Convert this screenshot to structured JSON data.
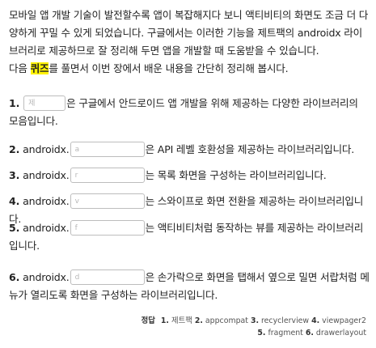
{
  "intro": {
    "line1": "모바일 앱 개발 기술이 발전할수록 앱이 복잡해지다 보니 액티비티의 화면도 조금 더 다양하게 꾸밀 수 있게 되었습니다. 구글에서는 이러한 기능을 제트팩의 androidx 라이브러리로 제공하므로 잘 정리해 두면 앱을 개발할 때 도움받을 수 있습니다.",
    "line2_before": "다음 ",
    "line2_highlight": "퀴즈",
    "line2_after": "를 풀면서 이번 장에서 배운 내용을 간단히 정리해 봅시다."
  },
  "questions": [
    {
      "num": "1.",
      "prefix": "",
      "blank_placeholder": "제",
      "text": "은 구글에서 안드로이드 앱 개발을 위해 제공하는 다양한 라이브러리의 모음입니다."
    },
    {
      "num": "2.",
      "prefix": "androidx.",
      "blank_placeholder": "a",
      "text": "은 API 레벨 호환성을 제공하는 라이브러리입니다."
    },
    {
      "num": "3.",
      "prefix": "androidx.",
      "blank_placeholder": "r",
      "text": "는 목록 화면을 구성하는 라이브러리입니다."
    },
    {
      "num": "4.",
      "prefix": "androidx.",
      "blank_placeholder": "v",
      "text": "는 스와이프로 화면 전환을 제공하는 라이브러리입니다."
    },
    {
      "num": "5.",
      "prefix": "androidx.",
      "blank_placeholder": "f",
      "text": "는 액티비티처럼 동작하는 뷰를 제공하는 라이브러리입니다."
    },
    {
      "num": "6.",
      "prefix": "androidx.",
      "blank_placeholder": "d",
      "text": "은 손가락으로 화면을 탭해서 옆으로 밀면 서랍처럼 메뉴가 열리도록 화면을 구성하는 라이브러리입니다."
    }
  ],
  "answers": {
    "label": "정답",
    "items": [
      {
        "n": "1.",
        "v": "제트팩"
      },
      {
        "n": "2.",
        "v": "appcompat"
      },
      {
        "n": "3.",
        "v": "recyclerview"
      },
      {
        "n": "4.",
        "v": "viewpager2"
      },
      {
        "n": "5.",
        "v": "fragment"
      },
      {
        "n": "6.",
        "v": "drawerlayout"
      }
    ]
  }
}
